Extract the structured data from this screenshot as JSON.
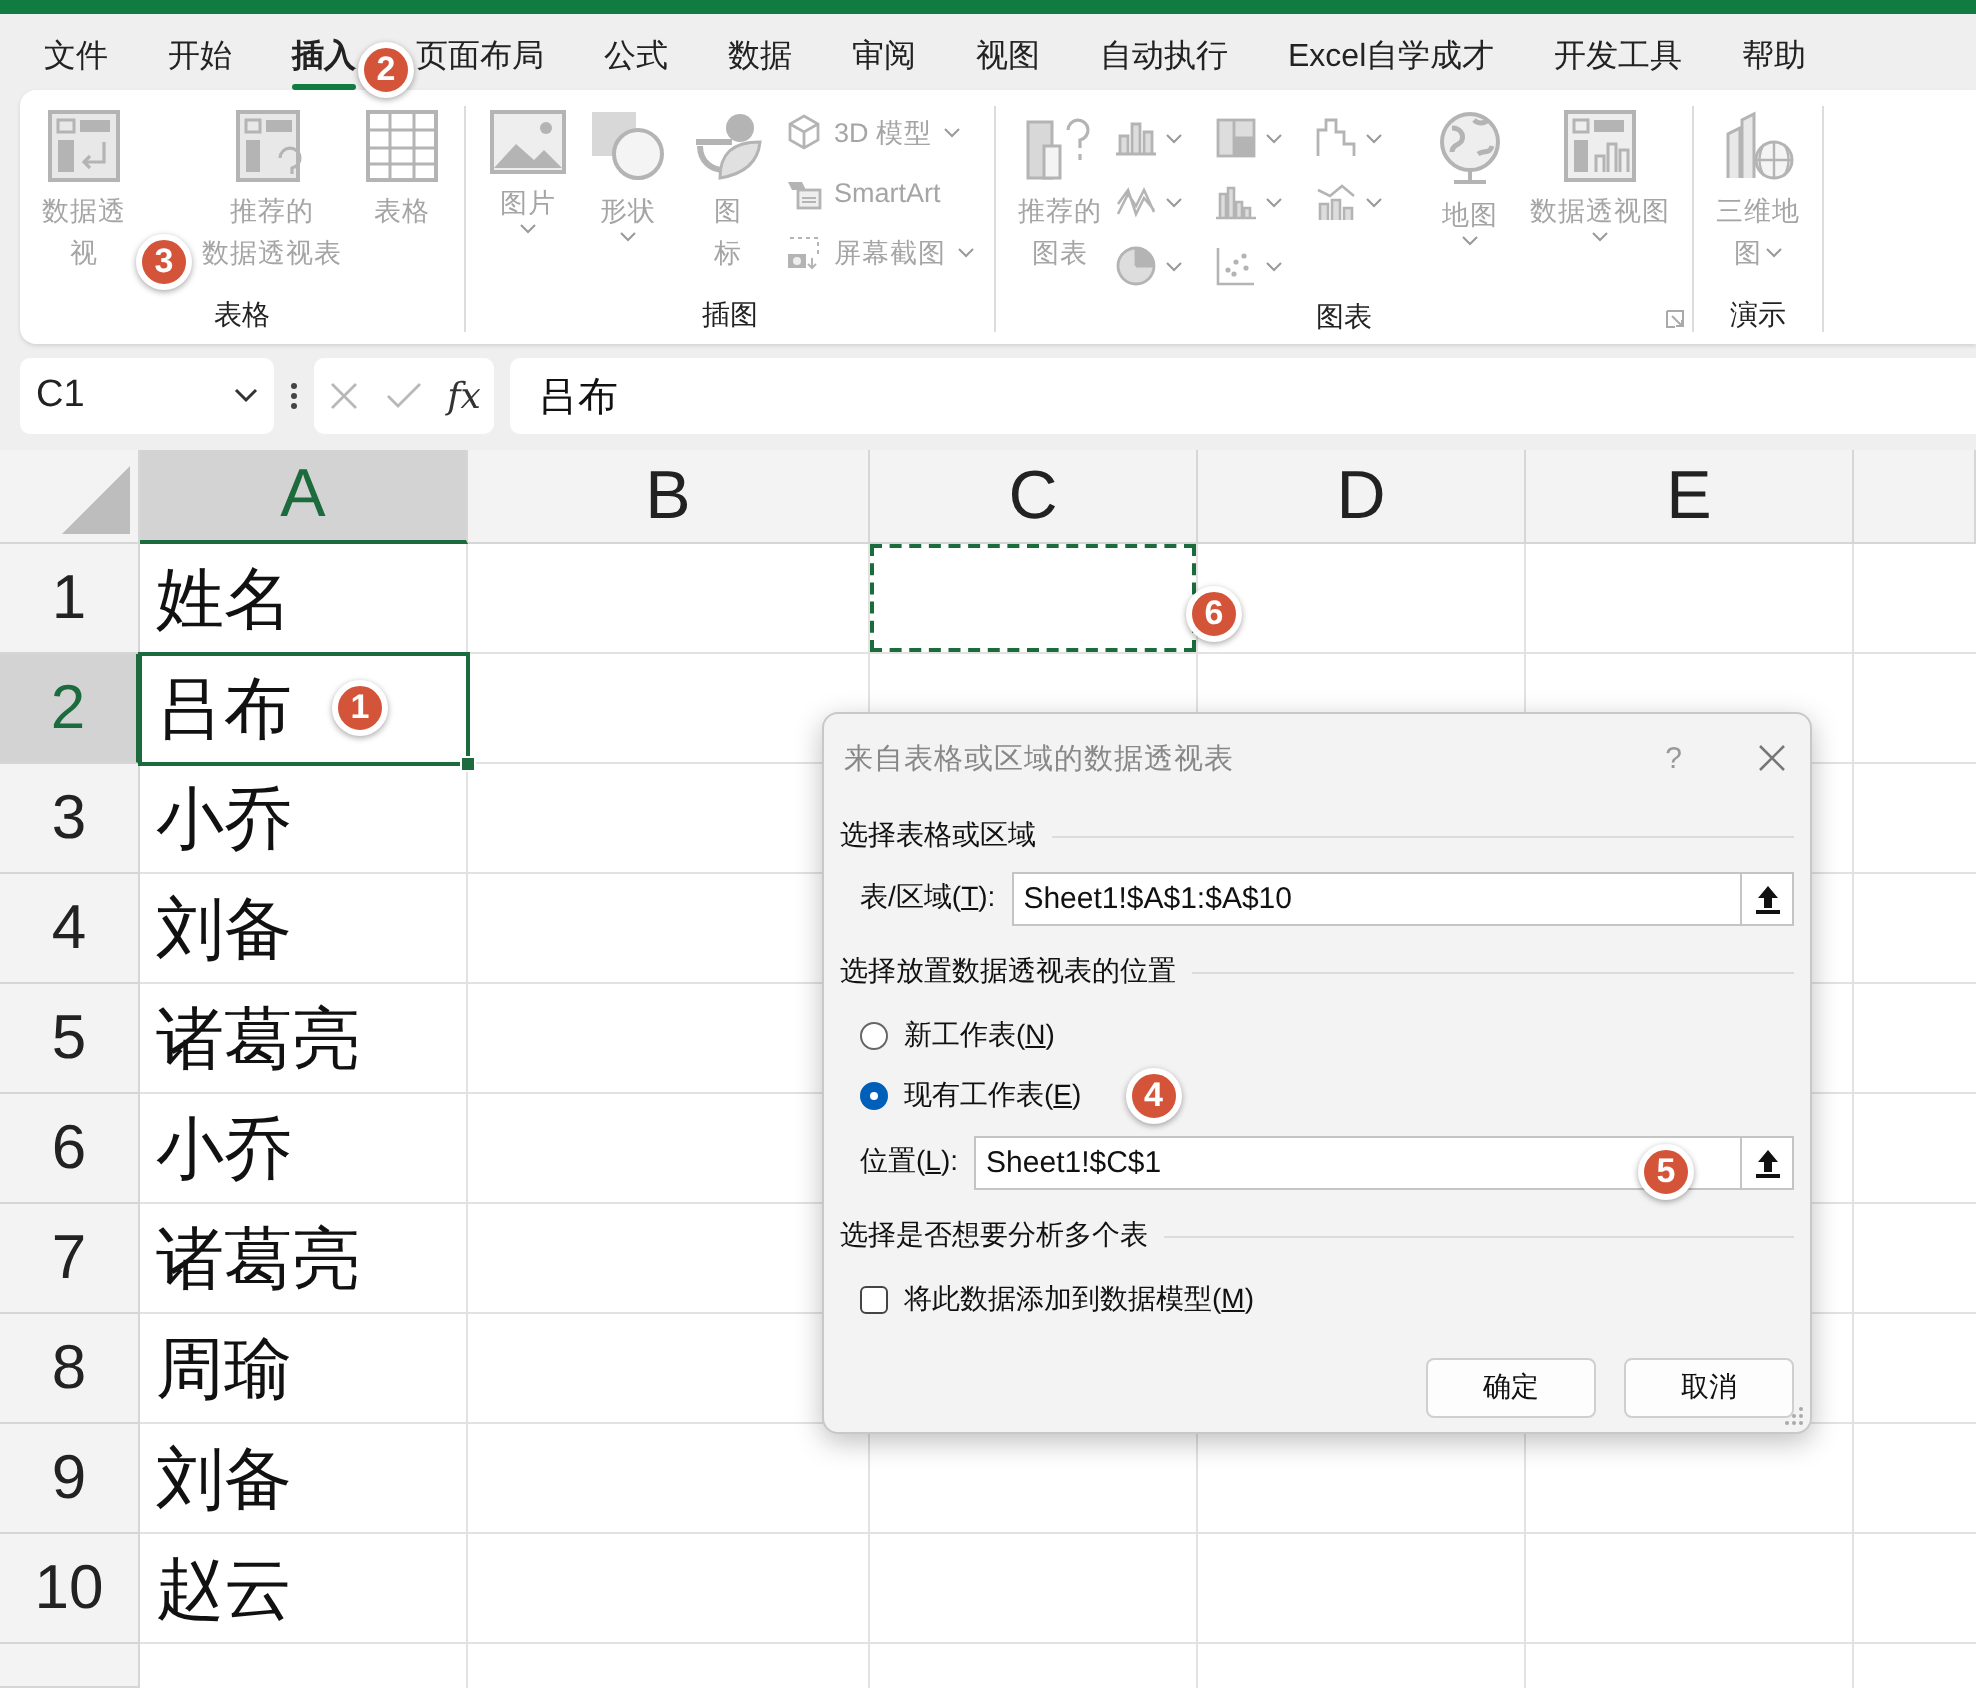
{
  "ribbon_tabs": [
    {
      "label": "文件",
      "selected": false
    },
    {
      "label": "开始",
      "selected": false
    },
    {
      "label": "插入",
      "selected": true,
      "callout": "2"
    },
    {
      "label": "页面布局",
      "selected": false
    },
    {
      "label": "公式",
      "selected": false
    },
    {
      "label": "数据",
      "selected": false
    },
    {
      "label": "审阅",
      "selected": false
    },
    {
      "label": "视图",
      "selected": false
    },
    {
      "label": "自动执行",
      "selected": false
    },
    {
      "label": "Excel自学成才",
      "selected": false
    },
    {
      "label": "开发工具",
      "selected": false
    },
    {
      "label": "帮助",
      "selected": false
    }
  ],
  "ribbon": {
    "disabled": true,
    "groups": [
      {
        "label": "表格",
        "launcher": false,
        "items": [
          {
            "kind": "large",
            "lines": [
              "数据透",
              "视"
            ],
            "dropdown": false,
            "callout": "3"
          },
          {
            "kind": "large",
            "lines": [
              "推荐的",
              "数据透视表"
            ],
            "dropdown": false
          },
          {
            "kind": "large",
            "lines": [
              "表格"
            ],
            "dropdown": false
          }
        ]
      },
      {
        "label": "插图",
        "launcher": false,
        "items": [
          {
            "kind": "large",
            "lines": [
              "图片"
            ],
            "dropdown": true
          },
          {
            "kind": "large",
            "lines": [
              "形状"
            ],
            "dropdown": true
          },
          {
            "kind": "large",
            "lines": [
              "图",
              "标"
            ],
            "dropdown": false
          },
          {
            "kind": "stack",
            "entries": [
              {
                "label": "3D 模型",
                "dropdown": true
              },
              {
                "label": "SmartArt",
                "dropdown": false
              },
              {
                "label": "屏幕截图",
                "dropdown": true
              }
            ]
          }
        ]
      },
      {
        "label": "图表",
        "launcher": true,
        "items": [
          {
            "kind": "large",
            "lines": [
              "推荐的",
              "图表"
            ],
            "dropdown": false
          },
          {
            "kind": "gallery",
            "entries": [
              {
                "dropdown": true
              },
              {
                "dropdown": true
              },
              {
                "dropdown": true
              },
              {
                "dropdown": true
              },
              {
                "dropdown": true
              },
              {
                "dropdown": true
              },
              {
                "dropdown": true
              },
              {
                "dropdown": true
              }
            ]
          },
          {
            "kind": "large",
            "lines": [
              "地图"
            ],
            "dropdown": true
          },
          {
            "kind": "large",
            "lines": [
              "数据透视图"
            ],
            "dropdown": true
          }
        ]
      },
      {
        "label": "演示",
        "launcher": false,
        "items": [
          {
            "kind": "large",
            "lines": [
              "三维地",
              "图"
            ],
            "dropdown": true
          }
        ]
      }
    ]
  },
  "formula_bar": {
    "name_box": "C1",
    "function_label": "fx",
    "formula": "吕布"
  },
  "sheet": {
    "columns": [
      {
        "label": "A",
        "selected": true
      },
      {
        "label": "B",
        "selected": false
      },
      {
        "label": "C",
        "selected": false
      },
      {
        "label": "D",
        "selected": false
      },
      {
        "label": "E",
        "selected": false
      }
    ],
    "rows": [
      {
        "label": "1",
        "selected": false,
        "value": "姓名",
        "active": false,
        "marquee": true,
        "callout": "6"
      },
      {
        "label": "2",
        "selected": true,
        "value": "吕布",
        "active": true,
        "marquee": false,
        "callout": "1"
      },
      {
        "label": "3",
        "selected": false,
        "value": "小乔",
        "active": false,
        "marquee": false
      },
      {
        "label": "4",
        "selected": false,
        "value": "刘备",
        "active": false,
        "marquee": false
      },
      {
        "label": "5",
        "selected": false,
        "value": "诸葛亮",
        "active": false,
        "marquee": false
      },
      {
        "label": "6",
        "selected": false,
        "value": "小乔",
        "active": false,
        "marquee": false
      },
      {
        "label": "7",
        "selected": false,
        "value": "诸葛亮",
        "active": false,
        "marquee": false
      },
      {
        "label": "8",
        "selected": false,
        "value": "周瑜",
        "active": false,
        "marquee": false
      },
      {
        "label": "9",
        "selected": false,
        "value": "刘备",
        "active": false,
        "marquee": false
      },
      {
        "label": "10",
        "selected": false,
        "value": "赵云",
        "active": false,
        "marquee": false
      }
    ]
  },
  "dialog": {
    "title": "来自表格或区域的数据透视表",
    "help": "?",
    "source_heading": "选择表格或区域",
    "range": {
      "label_parts": [
        "表/区域(",
        "T",
        "):"
      ],
      "value": "Sheet1!$A$1:$A$10"
    },
    "placement_heading": "选择放置数据透视表的位置",
    "placement_options": [
      {
        "label_parts": [
          "新工作表(",
          "N",
          ")"
        ],
        "selected": false
      },
      {
        "label_parts": [
          "现有工作表(",
          "E",
          ")"
        ],
        "selected": true,
        "callout": "4"
      }
    ],
    "location": {
      "label_parts": [
        "位置(",
        "L",
        "):"
      ],
      "value": "Sheet1!$C$1",
      "callout": "5"
    },
    "multi_heading": "选择是否想要分析多个表",
    "data_model": {
      "label_parts": [
        "将此数据添加到数据模型(",
        "M",
        ")"
      ],
      "checked": false
    },
    "buttons": [
      "确定",
      "取消"
    ]
  }
}
